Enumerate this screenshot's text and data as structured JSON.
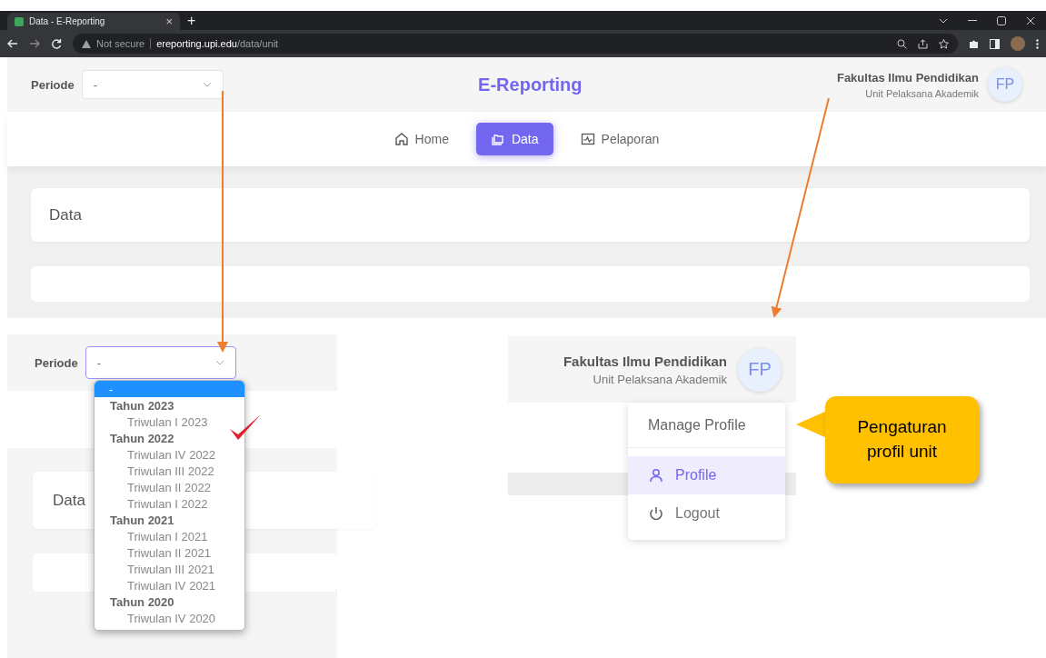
{
  "browser": {
    "tab_title": "Data - E-Reporting",
    "tab_close": "×",
    "new_tab": "+",
    "security": "Not secure",
    "url_host": "ereporting.upi.edu",
    "url_path": "/data/unit"
  },
  "app": {
    "period_label": "Periode",
    "period_value": "-",
    "title": "E-Reporting",
    "user_name": "Fakultas Ilmu Pendidikan",
    "user_role": "Unit Pelaksana Akademik",
    "avatar": "FP",
    "page_title": "Data",
    "nav": [
      {
        "label": "Home",
        "kind": "home",
        "selected": false
      },
      {
        "label": "Data",
        "kind": "folder",
        "selected": true
      },
      {
        "label": "Pelaporan",
        "kind": "chart",
        "selected": false
      }
    ]
  },
  "zoom_period": {
    "label": "Periode",
    "value": "-",
    "card_title": "Data",
    "options": [
      {
        "kind": "option",
        "label": "-",
        "selected": true,
        "ticked": false
      },
      {
        "kind": "group",
        "label": "Tahun 2023"
      },
      {
        "kind": "option",
        "label": "Triwulan I 2023",
        "selected": false,
        "ticked": true
      },
      {
        "kind": "group",
        "label": "Tahun 2022"
      },
      {
        "kind": "option",
        "label": "Triwulan IV 2022",
        "selected": false,
        "ticked": false
      },
      {
        "kind": "option",
        "label": "Triwulan III 2022",
        "selected": false,
        "ticked": false
      },
      {
        "kind": "option",
        "label": "Triwulan II 2022",
        "selected": false,
        "ticked": false
      },
      {
        "kind": "option",
        "label": "Triwulan I 2022",
        "selected": false,
        "ticked": false
      },
      {
        "kind": "group",
        "label": "Tahun 2021"
      },
      {
        "kind": "option",
        "label": "Triwulan I 2021",
        "selected": false,
        "ticked": false
      },
      {
        "kind": "option",
        "label": "Triwulan II 2021",
        "selected": false,
        "ticked": false
      },
      {
        "kind": "option",
        "label": "Triwulan III 2021",
        "selected": false,
        "ticked": false
      },
      {
        "kind": "option",
        "label": "Triwulan IV 2021",
        "selected": false,
        "ticked": false
      },
      {
        "kind": "group",
        "label": "Tahun 2020"
      },
      {
        "kind": "option",
        "label": "Triwulan IV 2020",
        "selected": false,
        "ticked": false
      }
    ]
  },
  "zoom_user": {
    "user_name": "Fakultas Ilmu Pendidikan",
    "user_role": "Unit Pelaksana Akademik",
    "avatar": "FP",
    "menu_header": "Manage Profile",
    "menu": [
      {
        "label": "Profile",
        "kind": "user",
        "selected": true
      },
      {
        "label": "Logout",
        "kind": "power",
        "selected": false
      }
    ]
  },
  "callout": {
    "text": "Pengaturan profil unit"
  }
}
